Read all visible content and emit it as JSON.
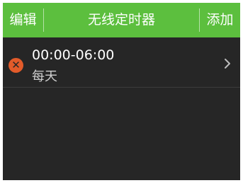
{
  "header": {
    "left_button": "编辑",
    "title": "无线定时器",
    "right_button": "添加"
  },
  "timers": [
    {
      "time_range": "00:00-06:00",
      "repeat": "每天",
      "delete_icon": "close-circle-icon",
      "arrow_icon": "chevron-right-icon"
    }
  ],
  "colors": {
    "header_bg": "#5cbf3e",
    "screen_bg": "#262626",
    "delete_icon": "#e25b2a"
  }
}
